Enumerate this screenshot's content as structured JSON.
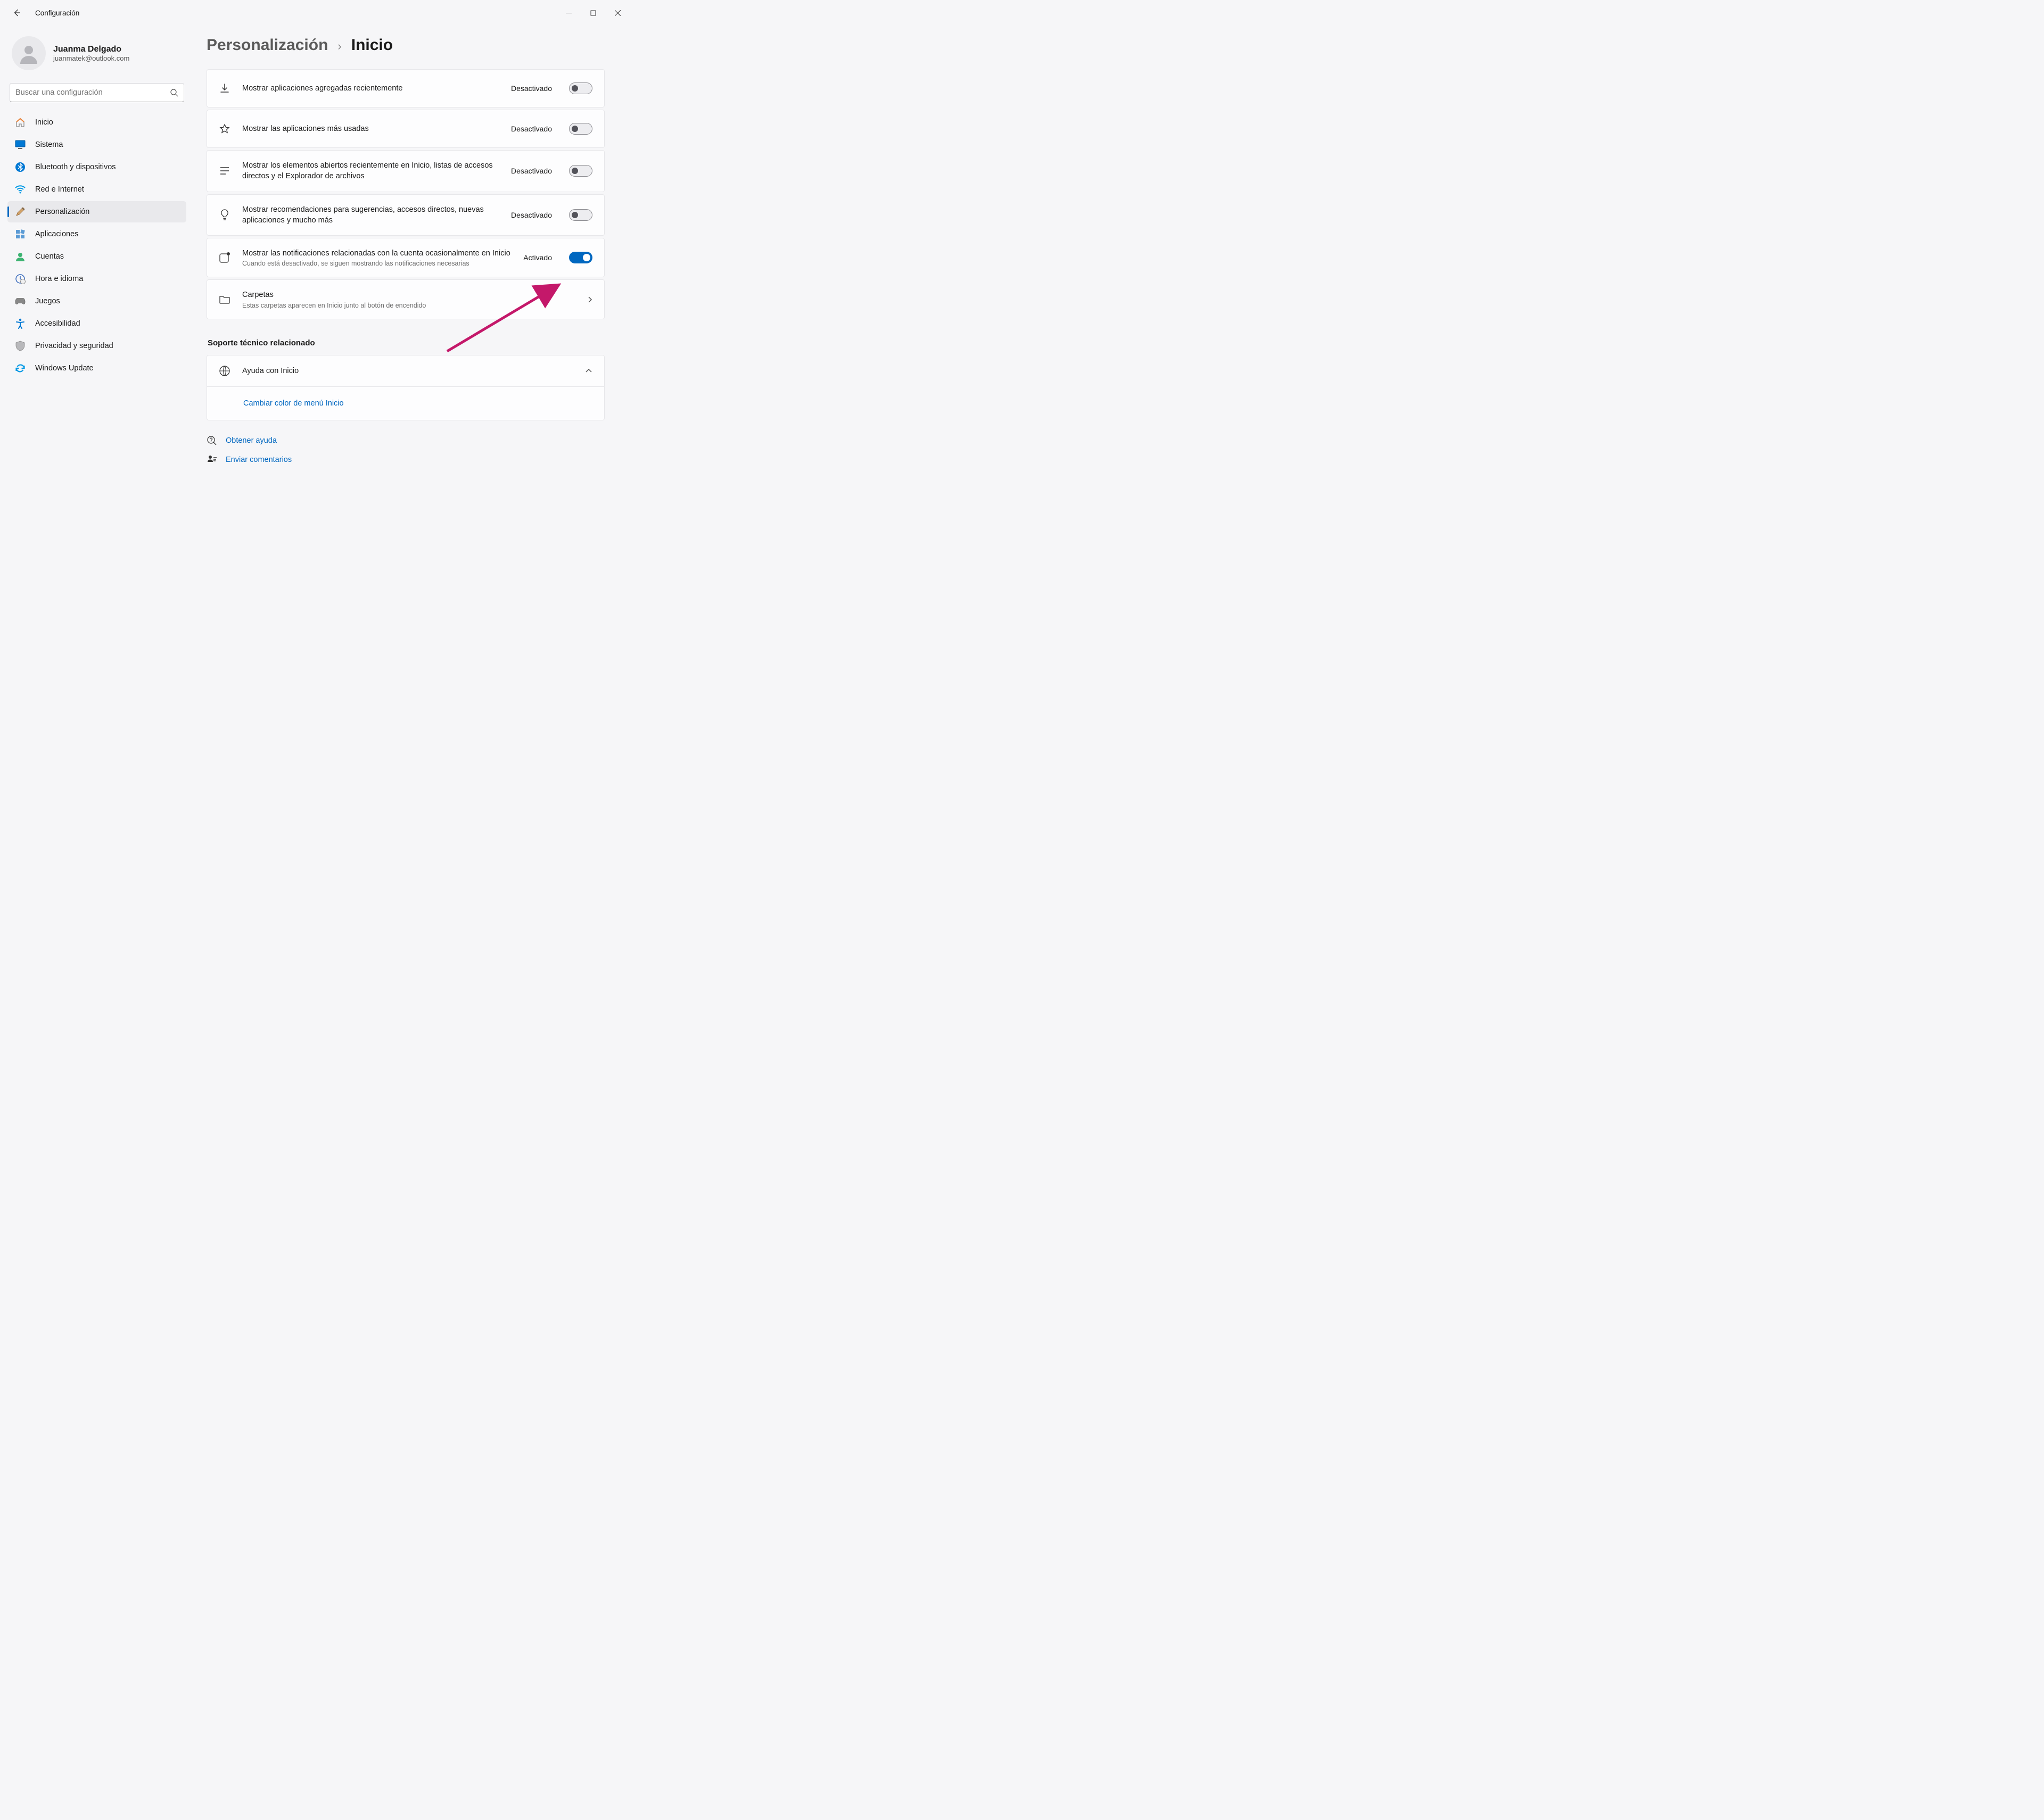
{
  "window": {
    "title": "Configuración"
  },
  "profile": {
    "name": "Juanma Delgado",
    "email": "juanmatek@outlook.com"
  },
  "search": {
    "placeholder": "Buscar una configuración"
  },
  "sidebar": {
    "items": [
      {
        "label": "Inicio"
      },
      {
        "label": "Sistema"
      },
      {
        "label": "Bluetooth y dispositivos"
      },
      {
        "label": "Red e Internet"
      },
      {
        "label": "Personalización"
      },
      {
        "label": "Aplicaciones"
      },
      {
        "label": "Cuentas"
      },
      {
        "label": "Hora e idioma"
      },
      {
        "label": "Juegos"
      },
      {
        "label": "Accesibilidad"
      },
      {
        "label": "Privacidad y seguridad"
      },
      {
        "label": "Windows Update"
      }
    ],
    "selected_index": 4
  },
  "breadcrumb": {
    "parent": "Personalización",
    "current": "Inicio"
  },
  "state_labels": {
    "on": "Activado",
    "off": "Desactivado"
  },
  "settings": [
    {
      "icon": "download",
      "title": "Mostrar aplicaciones agregadas recientemente",
      "sub": null,
      "state": "off"
    },
    {
      "icon": "star",
      "title": "Mostrar las aplicaciones más usadas",
      "sub": null,
      "state": "off"
    },
    {
      "icon": "list",
      "title": "Mostrar los elementos abiertos recientemente en Inicio, listas de accesos directos y el Explorador de archivos",
      "sub": null,
      "state": "off"
    },
    {
      "icon": "bulb",
      "title": "Mostrar recomendaciones para sugerencias, accesos directos, nuevas aplicaciones y mucho más",
      "sub": null,
      "state": "off"
    },
    {
      "icon": "badge",
      "title": "Mostrar las notificaciones relacionadas con la cuenta ocasionalmente en Inicio",
      "sub": "Cuando está desactivado, se siguen mostrando las notificaciones necesarias",
      "state": "on"
    },
    {
      "icon": "folder",
      "title": "Carpetas",
      "sub": "Estas carpetas aparecen en Inicio junto al botón de encendido",
      "nav": true
    }
  ],
  "support": {
    "section_title": "Soporte técnico relacionado",
    "header": "Ayuda con Inicio",
    "link": "Cambiar color de menú Inicio"
  },
  "footer": {
    "get_help": "Obtener ayuda",
    "feedback": "Enviar comentarios"
  }
}
